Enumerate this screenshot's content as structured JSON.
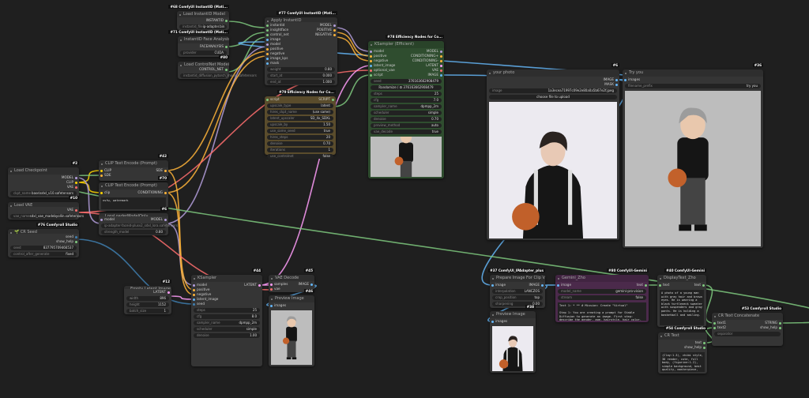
{
  "app": "ComfyUI",
  "colors": {
    "canvas": "#1f1f1f",
    "node": "#353535",
    "efficiency_green": "#2f4d2f",
    "hires_tan": "#5a4c2c",
    "gemini_purple": "#4b2a4b",
    "wire_model": "#b39ddb",
    "wire_conditioning": "#ffb43a",
    "wire_clip": "#ffd500",
    "wire_vae": "#ff6e6e",
    "wire_image": "#64b5f6",
    "wire_latent": "#ff9cf9",
    "wire_int": "#3f7fb0",
    "wire_string": "#aaaaaa"
  },
  "nodes": [
    {
      "id": "load-instantid-model",
      "tag": "#68 ComfyUI InstantID (Mati...",
      "title": "Load InstantID Model",
      "inputs": [],
      "outputs": [
        "INSTANTID"
      ],
      "widgets": [
        {
          "name": "instantid_file",
          "value": "ip-adapter.bin"
        }
      ]
    },
    {
      "id": "instantid-face-analysis",
      "tag": "#71 ComfyUI InstantID (Mati...",
      "title": "InstantID Face Analysis",
      "inputs": [],
      "outputs": [
        "FACEANALYSIS"
      ],
      "widgets": [
        {
          "name": "provider",
          "value": "CUDA"
        }
      ]
    },
    {
      "id": "load-controlnet-model",
      "tag": "#80",
      "title": "Load ControlNet Model",
      "inputs": [],
      "outputs": [
        "CONTROL_NET"
      ],
      "widgets": [
        {
          "name": "instantid_diffusion_pytorch_model.safetensors",
          "value": ""
        }
      ]
    },
    {
      "id": "apply-instantid",
      "tag": "#77 ComfyUI InstantID (Mati...",
      "title": "Apply InstantID",
      "inputs": [
        "instantid",
        "insightface",
        "control_net",
        "image",
        "model",
        "positive",
        "negative",
        "image_kps",
        "mask"
      ],
      "outputs": [
        "MODEL",
        "POSITIVE",
        "NEGATIVE"
      ],
      "widgets": [
        {
          "name": "weight",
          "value": "0.80"
        },
        {
          "name": "start_at",
          "value": "0.000"
        },
        {
          "name": "end_at",
          "value": "1.000"
        }
      ]
    },
    {
      "id": "highres-fix-script",
      "tag": "#79 Efficiency Nodes for Co...",
      "title": "HighRes-Fix Script",
      "inputs": [
        "script"
      ],
      "outputs": [
        "SCRIPT"
      ],
      "widgets": [
        {
          "name": "upscale_type",
          "value": "latent"
        },
        {
          "name": "hires_ckpt_name",
          "value": "(use same)"
        },
        {
          "name": "latent_upscaler",
          "value": "SD_4x_SDXL"
        },
        {
          "name": "upscale_by",
          "value": "1.50"
        },
        {
          "name": "use_same_seed",
          "value": "true"
        },
        {
          "name": "hires_steps",
          "value": "20"
        },
        {
          "name": "denoise",
          "value": "0.70"
        },
        {
          "name": "iterations",
          "value": "1"
        },
        {
          "name": "use_controlnet",
          "value": "false"
        }
      ]
    },
    {
      "id": "ksampler-efficient",
      "tag": "#78 Efficiency Nodes for Co...",
      "title": "KSampler (Efficient)",
      "inputs": [
        "model",
        "positive",
        "negative",
        "latent_image",
        "optional_vae",
        "script"
      ],
      "outputs": [
        "MODEL",
        "CONDITIONING+",
        "CONDITIONING-",
        "LATENT",
        "VAE",
        "IMAGE"
      ],
      "widgets": [
        {
          "name": "seed",
          "value": "376163662908479"
        },
        {
          "name": "",
          "value": "Randomize / ♻ 376163662908479",
          "button": true
        },
        {
          "name": "steps",
          "value": "25"
        },
        {
          "name": "cfg",
          "value": "7.0"
        },
        {
          "name": "sampler_name",
          "value": "dpmpp_2m"
        },
        {
          "name": "scheduler",
          "value": "simple"
        },
        {
          "name": "denoise",
          "value": "0.70"
        },
        {
          "name": "preview_method",
          "value": "auto"
        },
        {
          "name": "vae_decode",
          "value": "true"
        }
      ],
      "image": "figurine"
    },
    {
      "id": "your-photo",
      "tag": "#6",
      "title": "your photo",
      "inputs": [],
      "outputs": [
        "IMAGE",
        "MASK"
      ],
      "widgets": [
        {
          "name": "image",
          "value": "1a3ecea71997c09e2e80a0a5b67e2f.jpeg"
        },
        {
          "name": "",
          "value": "choose file to upload",
          "button": true
        }
      ],
      "image": "photo"
    },
    {
      "id": "try-you",
      "tag": "#36",
      "title": "Try you",
      "inputs": [
        "images"
      ],
      "outputs": [],
      "widgets": [
        {
          "name": "filename_prefix",
          "value": "try you"
        }
      ],
      "image": "figurine"
    },
    {
      "id": "load-checkpoint",
      "tag": "#2",
      "title": "Load Checkpoint",
      "inputs": [],
      "outputs": [
        "MODEL",
        "CLIP",
        "VAE"
      ],
      "widgets": [
        {
          "name": "ckpt_name",
          "value": "base\\sdxl_v10.safetensors"
        }
      ]
    },
    {
      "id": "load-vae",
      "tag": "#10",
      "title": "Load VAE",
      "inputs": [],
      "outputs": [
        "VAE"
      ],
      "widgets": [
        {
          "name": "vae_name",
          "value": "sdxl_vae_madebyollin.safetensors"
        }
      ]
    },
    {
      "id": "cr-seed",
      "tag": "#76 Comfyroll Studio",
      "title": "🌱 CR Seed",
      "inputs": [],
      "outputs": [
        "seed",
        "show_help"
      ],
      "widgets": [
        {
          "name": "seed",
          "value": "837795709466537"
        },
        {
          "name": "control_after_generate",
          "value": "fixed"
        }
      ]
    },
    {
      "id": "clip-text-encode-positive",
      "tag": "#42",
      "title": "CLIP Text Encode (Prompt)",
      "inputs": [
        "CLIP",
        "SDE"
      ],
      "outputs": [
        "SDE"
      ],
      "widgets": []
    },
    {
      "id": "clip-text-encode-negative",
      "tag": "#70",
      "title": "CLIP Text Encode (Prompt)",
      "inputs": [
        "clip"
      ],
      "outputs": [
        "CONDITIONING"
      ],
      "widgets": [],
      "text": "nsfw, watermark"
    },
    {
      "id": "lora-loader-model-only",
      "tag": "#6",
      "title": "LoraLoaderModelOnly",
      "inputs": [
        "model"
      ],
      "outputs": [
        "MODEL"
      ],
      "widgets": [
        {
          "name": "ip-adapter-faceid-plusv2_sdxl_lora.safetensors",
          "value": ""
        },
        {
          "name": "strength_model",
          "value": "0.80"
        }
      ]
    },
    {
      "id": "empty-latent-image",
      "tag": "#12",
      "title": "Empty Latent Image",
      "inputs": [],
      "outputs": [
        "LATENT"
      ],
      "widgets": [
        {
          "name": "width",
          "value": "896"
        },
        {
          "name": "height",
          "value": "1152"
        },
        {
          "name": "batch_size",
          "value": "1"
        }
      ]
    },
    {
      "id": "ksampler",
      "tag": "#44",
      "title": "KSampler",
      "inputs": [
        "model",
        "positive",
        "negative",
        "latent_image",
        "seed"
      ],
      "outputs": [
        "LATENT"
      ],
      "widgets": [
        {
          "name": "steps",
          "value": "25"
        },
        {
          "name": "cfg",
          "value": "8.0"
        },
        {
          "name": "sampler_name",
          "value": "dpmpp_2m"
        },
        {
          "name": "scheduler",
          "value": "simple"
        },
        {
          "name": "denoise",
          "value": "1.00"
        }
      ]
    },
    {
      "id": "vae-decode",
      "tag": "#45",
      "title": "VAE Decode",
      "inputs": [
        "samples",
        "vae"
      ],
      "outputs": [
        "IMAGE"
      ],
      "widgets": []
    },
    {
      "id": "preview-image-1",
      "tag": "#46",
      "title": "Preview Image",
      "inputs": [
        "images"
      ],
      "outputs": [],
      "widgets": [],
      "image": "figurine"
    },
    {
      "id": "prepare-image-clip-vision",
      "tag": "#37 ComfyUI_IPAdapter_plus",
      "title": "Prepare Image For Clip Vision",
      "inputs": [
        "image"
      ],
      "outputs": [
        "IMAGE"
      ],
      "widgets": [
        {
          "name": "interpolation",
          "value": "LANCZOS"
        },
        {
          "name": "crop_position",
          "value": "top"
        },
        {
          "name": "sharpening",
          "value": "0.00"
        }
      ]
    },
    {
      "id": "preview-image-2",
      "tag": "#38",
      "title": "Preview Image",
      "inputs": [
        "images"
      ],
      "outputs": [],
      "widgets": [],
      "image": "photo"
    },
    {
      "id": "gemini-zho",
      "tag": "#80 ComfyUI-Gemini",
      "title": "Gemini_Zho",
      "inputs": [
        "image"
      ],
      "outputs": [
        "text"
      ],
      "widgets": [
        {
          "name": "model_name",
          "value": "gemini-pro-vision"
        },
        {
          "name": "stream",
          "value": "false"
        }
      ],
      "text": "Text 1: * ** # Mission: Create \"Virtual\"\n\nStep 1: You are creating a prompt for Stable Diffusion to generate an image. First step: describe the gender, age, hairstyle, hair color, eye color, clothing of the person in the photo. Then add descriptions that could be used to generate a realistic image, output must be in English only."
    },
    {
      "id": "display-text-zho",
      "tag": "#40 ComfyUI-Gemini",
      "title": "DisplayText_Zho",
      "inputs": [
        "text"
      ],
      "outputs": [
        "text"
      ],
      "widgets": [],
      "text": "A photo of a young man with gray hair and brown eyes. He is wearing a black turtleneck sweater with suspenders and gray pants. He is holding a basketball and smiling."
    },
    {
      "id": "cr-text-concatenate",
      "tag": "#53 Comfyroll Studio",
      "title": "CR Text Concatenate",
      "inputs": [
        "text1",
        "text2"
      ],
      "outputs": [
        "STRING",
        "show_help"
      ],
      "widgets": [
        {
          "name": "separator",
          "value": ""
        }
      ]
    },
    {
      "id": "cr-text",
      "tag": "#54 Comfyroll Studio",
      "title": "CR Text",
      "inputs": [],
      "outputs": [
        "text",
        "show_help"
      ],
      "widgets": [],
      "text": "(Clay:1.3), chibi style, 3D render, cute, full body, (figurine:1.2), simple background, best quality, masterpiece, highly detailed"
    }
  ]
}
